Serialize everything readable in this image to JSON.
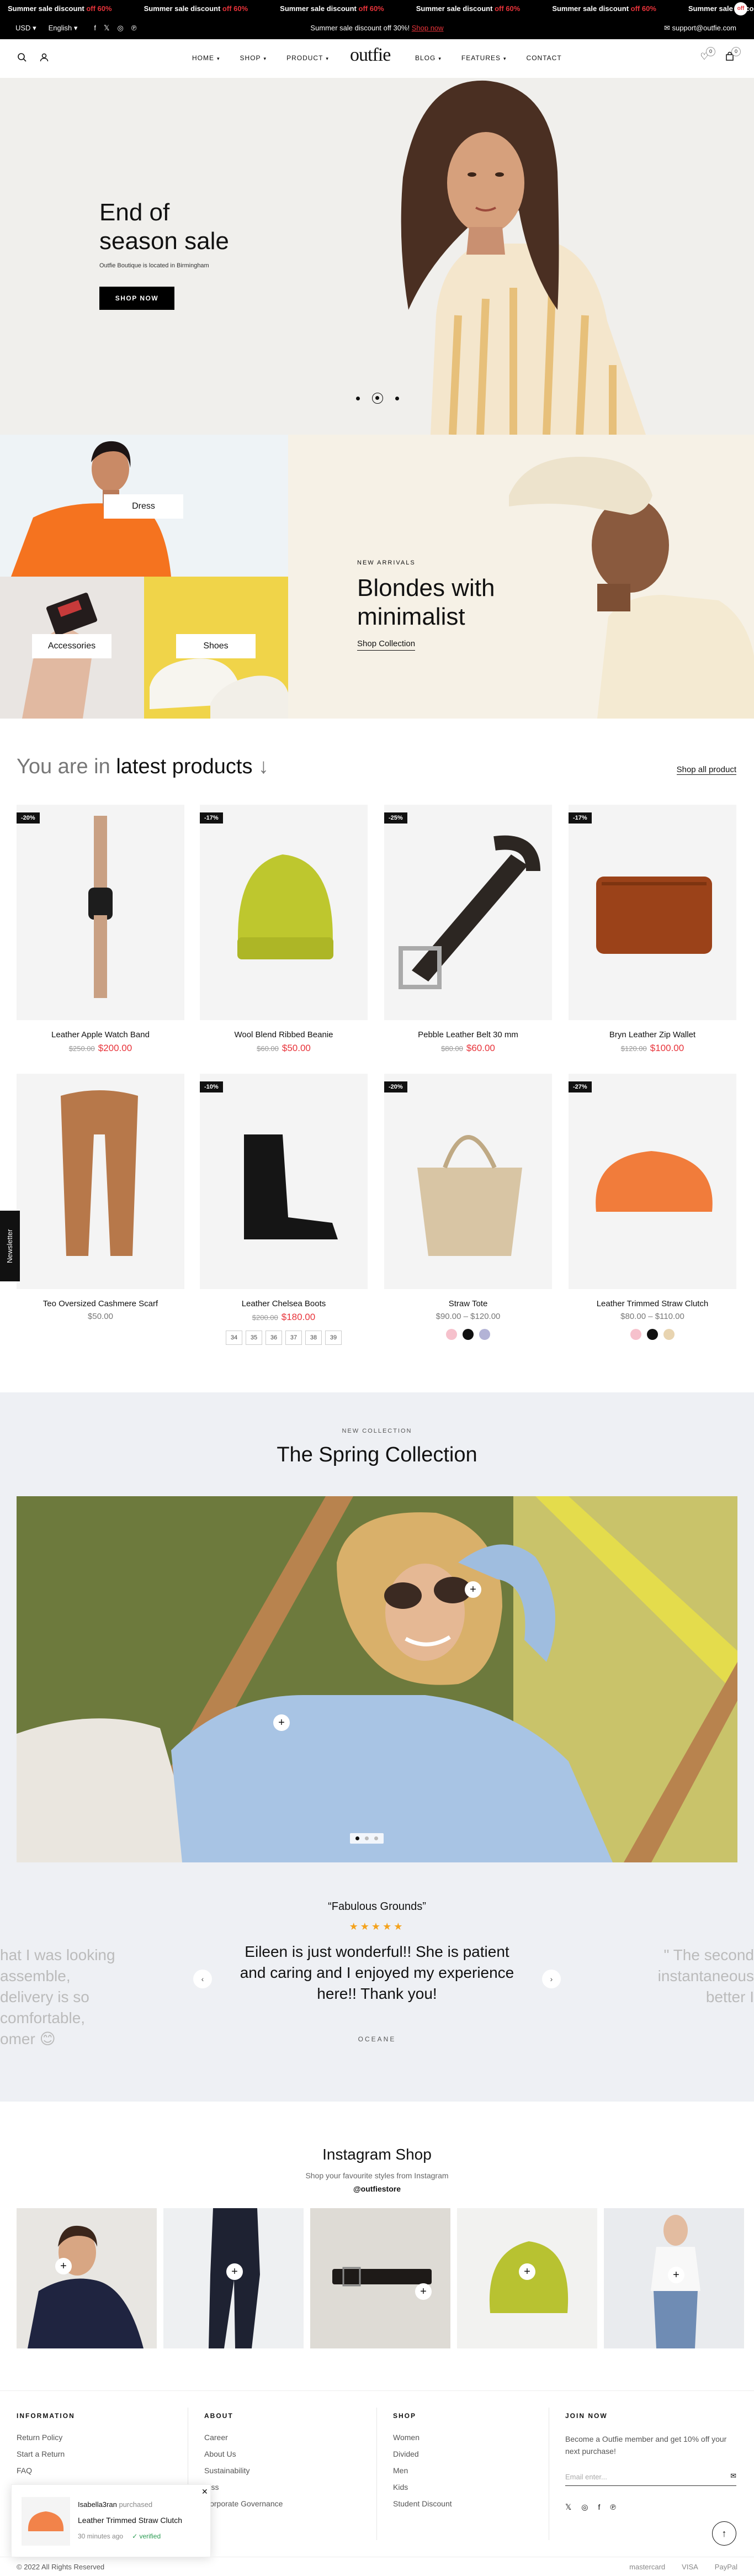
{
  "ticker": {
    "items": [
      {
        "text": "Summer sale discount",
        "off": "off 60%"
      },
      {
        "text": "Summer sale discount",
        "off": "off 60%"
      },
      {
        "text": "Summer sale discount",
        "off": "off 60%"
      },
      {
        "text": "Summer sale discount",
        "off": "off 60%"
      },
      {
        "text": "Summer sale discount",
        "off": "off 60%"
      },
      {
        "text": "Summer sale discount",
        "off": "off 60%"
      }
    ],
    "dot_label": "off"
  },
  "topbar": {
    "currency": "USD",
    "language": "English",
    "promo": "Summer sale discount off 30%!",
    "promo_link": "Shop now",
    "email": "support@outfie.com"
  },
  "header": {
    "logo": "outfie",
    "nav_left": [
      "HOME",
      "SHOP",
      "PRODUCT"
    ],
    "nav_right": [
      "BLOG",
      "FEATURES",
      "CONTACT"
    ],
    "wishlist_count": "0",
    "cart_count": "0"
  },
  "hero": {
    "title": "End of season sale",
    "subtitle": "Outfie Boutique is located in Birmingham",
    "button": "SHOP NOW"
  },
  "banners": {
    "dress": "Dress",
    "accessories": "Accessories",
    "shoes": "Shoes",
    "new_arrivals": "NEW ARRIVALS",
    "blondes_title": "Blondes with minimalist",
    "shop_collection": "Shop Collection"
  },
  "latest": {
    "title_prefix": "You are in",
    "title_bold": "latest products",
    "shop_all": "Shop all product",
    "products": [
      {
        "name": "Leather Apple Watch Band",
        "discount": "-20%",
        "old": "$250.00",
        "price": "$200.00"
      },
      {
        "name": "Wool Blend Ribbed Beanie",
        "discount": "-17%",
        "old": "$60.00",
        "price": "$50.00"
      },
      {
        "name": "Pebble Leather Belt 30 mm",
        "discount": "-25%",
        "old": "$80.00",
        "price": "$60.00"
      },
      {
        "name": "Bryn Leather Zip Wallet",
        "discount": "-17%",
        "old": "$120.00",
        "price": "$100.00"
      },
      {
        "name": "Teo Oversized Cashmere Scarf",
        "discount": "",
        "old": "",
        "price": "$50.00"
      },
      {
        "name": "Leather Chelsea Boots",
        "discount": "-10%",
        "old": "$200.00",
        "price": "$180.00",
        "sizes": [
          "34",
          "35",
          "36",
          "37",
          "38",
          "39"
        ]
      },
      {
        "name": "Straw Tote",
        "discount": "-20%",
        "old": "",
        "price": "$90.00 – $120.00",
        "swatches": [
          "#f6c1cc",
          "#111111",
          "#b3b3d6"
        ]
      },
      {
        "name": "Leather Trimmed Straw Clutch",
        "discount": "-27%",
        "old": "",
        "price": "$80.00 – $110.00",
        "swatches": [
          "#f6c1cc",
          "#111111",
          "#e8d4b0"
        ]
      }
    ]
  },
  "newsletter_tab": "Newsletter",
  "spring": {
    "label": "NEW COLLECTION",
    "title": "The Spring Collection"
  },
  "testimonial": {
    "quote_title": "“Fabulous Grounds”",
    "stars": "★★★★★",
    "text": "Eileen is just wonderful!! She is patient and caring and I enjoyed my experience here!! Thank you!",
    "author": "OCEANE",
    "ghost_left": "hat I was looking assemble, delivery is so comfortable, omer 😊",
    "ghost_right": "\" The second instantaneous better I"
  },
  "instagram": {
    "title": "Instagram Shop",
    "subtitle": "Shop your favourite styles from Instagram",
    "handle": "@outfiestore"
  },
  "footer": {
    "info_title": "INFORMATION",
    "info_links": [
      "Return Policy",
      "Start a Return",
      "FAQ"
    ],
    "about_title": "ABOUT",
    "about_links": [
      "Career",
      "About Us",
      "Sustainability",
      "ress",
      "Corporate Governance"
    ],
    "shop_title": "SHOP",
    "shop_links": [
      "Women",
      "Divided",
      "Men",
      "Kids",
      "Student Discount"
    ],
    "join_title": "JOIN NOW",
    "join_text": "Become a Outfie member and get 10% off your next purchase!",
    "email_placeholder": "Email enter...",
    "copyright": "© 2022 All Rights Reserved",
    "payments": [
      "mastercard",
      "VISA",
      "PayPal"
    ]
  },
  "toast": {
    "user": "Isabella3ran",
    "action": "purchased",
    "product": "Leather Trimmed Straw Clutch",
    "time": "30 minutes ago",
    "verified": "verified"
  }
}
